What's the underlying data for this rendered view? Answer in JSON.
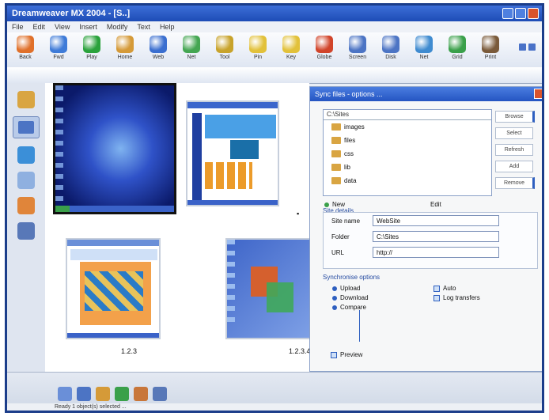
{
  "titlebar": {
    "title": "Dreamweaver MX 2004 - [S..]"
  },
  "menu": [
    "File",
    "Edit",
    "View",
    "Insert",
    "Modify",
    "Text",
    "Help"
  ],
  "toolbar": {
    "tools": [
      {
        "label": "Back",
        "color": "#e0702a"
      },
      {
        "label": "Fwd",
        "color": "#3e7bd8"
      },
      {
        "label": "Play",
        "color": "#2aa23c"
      },
      {
        "label": "Home",
        "color": "#d59a38"
      },
      {
        "label": "Web",
        "color": "#3b6fd0"
      },
      {
        "label": "Net",
        "color": "#44a652"
      },
      {
        "label": "Tool",
        "color": "#c8a32b"
      },
      {
        "label": "Pin",
        "color": "#e2c13a"
      },
      {
        "label": "Key",
        "color": "#e2c13a"
      },
      {
        "label": "Globe",
        "color": "#d1442a"
      },
      {
        "label": "Screen",
        "color": "#4c74c4"
      },
      {
        "label": "Disk",
        "color": "#4c74c4"
      },
      {
        "label": "Net",
        "color": "#3f8bd0"
      },
      {
        "label": "Grid",
        "color": "#3aa04a"
      },
      {
        "label": "Print",
        "color": "#7a5a3a"
      }
    ]
  },
  "sidebar": {
    "icons": [
      {
        "name": "folder-icon",
        "color": "#d9a542"
      },
      {
        "name": "thumbs-icon",
        "color": "#4c74c4"
      },
      {
        "name": "globe-icon",
        "color": "#3b8fd8"
      },
      {
        "name": "doc-icon",
        "color": "#8fb0e0"
      },
      {
        "name": "book-icon",
        "color": "#e0853a"
      },
      {
        "name": "user-icon",
        "color": "#5878b8"
      }
    ]
  },
  "thumbs": [
    {
      "caption": "",
      "selected": true
    },
    {
      "caption": "",
      "selected": false
    },
    {
      "caption": "1.2.3",
      "selected": false
    },
    {
      "caption": "1.2.3.4",
      "selected": false
    }
  ],
  "dialog": {
    "title": "Sync files - options ...",
    "path": "C:\\Sites",
    "folders": [
      "images",
      "files",
      "css",
      "lib",
      "data"
    ],
    "buttons": [
      "Browse",
      "Select",
      "Refresh",
      "Add",
      "Remove"
    ],
    "row_labels": {
      "new": "New",
      "mid": "Edit"
    },
    "section1": "Site details",
    "fields": [
      {
        "label": "Site name",
        "value": "WebSite"
      },
      {
        "label": "Folder",
        "value": "C:\\Sites"
      },
      {
        "label": "URL",
        "value": "http://"
      }
    ],
    "section2": "Synchronise options",
    "options_left": [
      "Upload",
      "Download",
      "Compare"
    ],
    "options_right": [
      "Auto",
      "Log transfers"
    ],
    "footer_check": "Preview"
  },
  "statusbar": {
    "text": "Ready  1 object(s) selected  ..."
  },
  "colors": {
    "accent": "#1d4cb6"
  }
}
